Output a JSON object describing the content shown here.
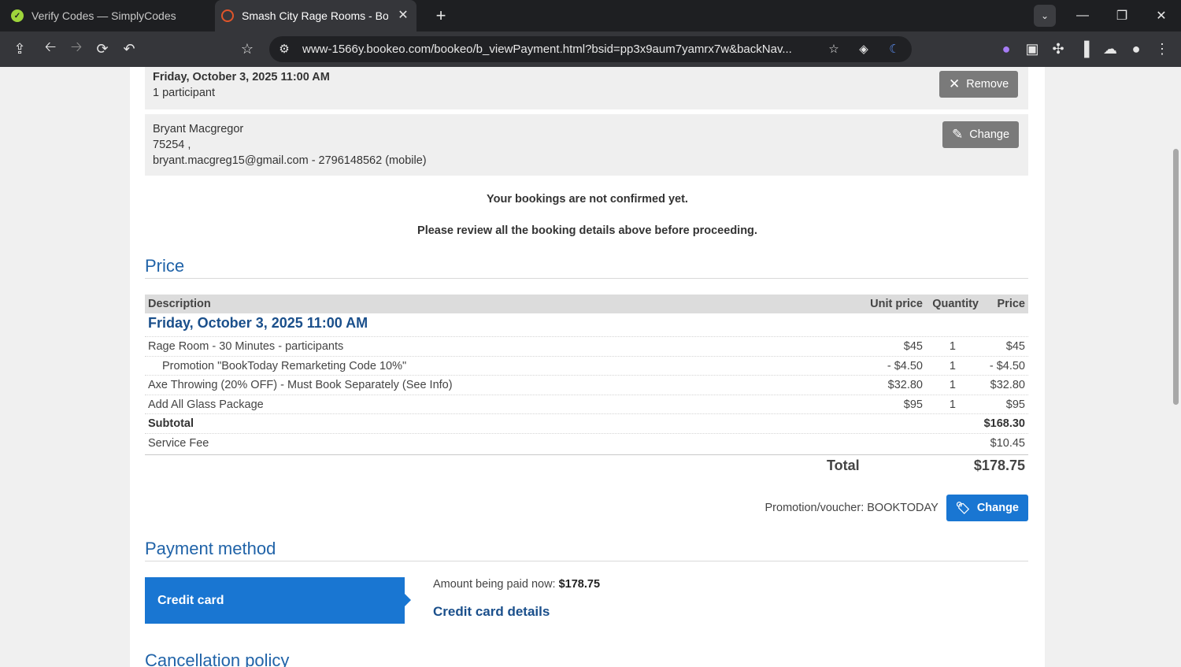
{
  "browser": {
    "tabs": [
      {
        "title": "Verify Codes — SimplyCodes",
        "active": false
      },
      {
        "title": "Smash City Rage Rooms - Booking",
        "active": true
      }
    ],
    "url": "www-1566y.bookeo.com/bookeo/b_viewPayment.html?bsid=pp3x9aum7yamrx7w&backNav..."
  },
  "booking": {
    "datetime": "Friday, October 3, 2025 11:00 AM",
    "participants": "1 participant",
    "remove_label": "Remove"
  },
  "customer": {
    "name": "Bryant Macgregor",
    "postal": "75254 ,",
    "contact": "bryant.macgreg15@gmail.com - 2796148562 (mobile)",
    "change_label": "Change"
  },
  "notices": {
    "not_confirmed": "Your bookings are not confirmed yet.",
    "review": "Please review all the booking details above before proceeding."
  },
  "price": {
    "section_title": "Price",
    "headers": {
      "description": "Description",
      "unit_price": "Unit price",
      "quantity": "Quantity",
      "price": "Price"
    },
    "date_heading": "Friday, October 3, 2025 11:00 AM",
    "lines": [
      {
        "description": "Rage Room - 30 Minutes - participants",
        "unit_price": "$45",
        "quantity": "1",
        "price": "$45"
      },
      {
        "description": "Promotion \"BookToday Remarketing Code 10%\"",
        "unit_price": "- $4.50",
        "quantity": "1",
        "price": "- $4.50"
      },
      {
        "description": "Axe Throwing (20% OFF) - Must Book Separately (See Info)",
        "unit_price": "$32.80",
        "quantity": "1",
        "price": "$32.80"
      },
      {
        "description": "Add All Glass Package",
        "unit_price": "$95",
        "quantity": "1",
        "price": "$95"
      }
    ],
    "subtotal_label": "Subtotal",
    "subtotal_value": "$168.30",
    "service_fee_label": "Service Fee",
    "service_fee_value": "$10.45",
    "total_label": "Total",
    "total_value": "$178.75",
    "promo_label": "Promotion/voucher: BOOKTODAY",
    "promo_change_label": "Change"
  },
  "payment": {
    "section_title": "Payment method",
    "method_label": "Credit card",
    "amount_label": "Amount being paid now:",
    "amount_value": "$178.75",
    "details_label": "Credit card details"
  },
  "cancellation": {
    "section_title": "Cancellation policy"
  },
  "colors": {
    "accent_blue": "#1976d2",
    "heading_blue": "#2063a8",
    "dark_blue": "#1a4f8b",
    "gray_button": "#7a7a7a"
  }
}
